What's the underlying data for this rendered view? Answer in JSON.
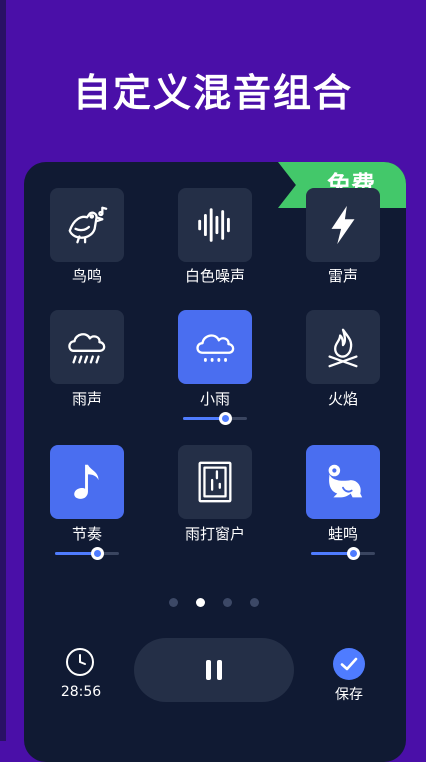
{
  "headline": "自定义混音组合",
  "badge": "免费",
  "sounds": [
    {
      "label": "鸟鸣",
      "icon": "bird-icon",
      "active": false
    },
    {
      "label": "白色噪声",
      "icon": "sound-wave-icon",
      "active": false
    },
    {
      "label": "雷声",
      "icon": "lightning-icon",
      "active": false
    },
    {
      "label": "雨声",
      "icon": "rain-cloud-icon",
      "active": false
    },
    {
      "label": "小雨",
      "icon": "light-rain-icon",
      "active": true,
      "volume": 0.65
    },
    {
      "label": "火焰",
      "icon": "fire-icon",
      "active": false
    },
    {
      "label": "节奏",
      "icon": "music-note-icon",
      "active": true,
      "volume": 0.65
    },
    {
      "label": "雨打窗户",
      "icon": "window-rain-icon",
      "active": false
    },
    {
      "label": "蛙鸣",
      "icon": "frog-icon",
      "active": true,
      "volume": 0.65
    }
  ],
  "pager": {
    "count": 4,
    "current": 2
  },
  "timer": {
    "value": "28:56",
    "icon": "clock-icon"
  },
  "play_button": {
    "icon": "pause-icon"
  },
  "save": {
    "label": "保存",
    "icon": "checkmark-icon"
  },
  "colors": {
    "background": "#4a0fa8",
    "card": "#101a33",
    "tile": "#242f47",
    "tile_active": "#4a6ef0",
    "badge": "#43c86a",
    "accent": "#4f7cff"
  }
}
